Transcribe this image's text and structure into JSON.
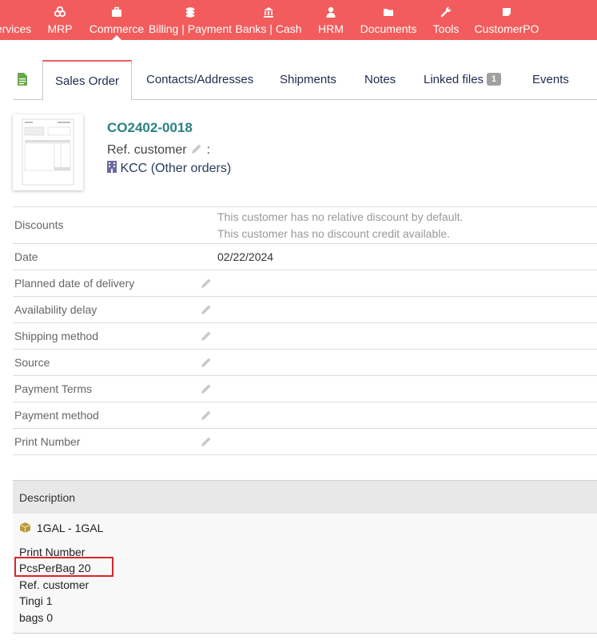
{
  "topnav": {
    "items": [
      {
        "label": "ervices",
        "icon": "services-icon"
      },
      {
        "label": "MRP",
        "icon": "cubes-icon"
      },
      {
        "label": "Commerce",
        "icon": "briefcase-icon",
        "active": true
      },
      {
        "label": "Billing | Payment",
        "icon": "coins-icon"
      },
      {
        "label": "Banks | Cash",
        "icon": "bank-icon"
      },
      {
        "label": "HRM",
        "icon": "user-tie-icon"
      },
      {
        "label": "Documents",
        "icon": "folder-icon"
      },
      {
        "label": "Tools",
        "icon": "wrench-icon"
      },
      {
        "label": "CustomerPO",
        "icon": "sticky-note-icon"
      }
    ],
    "color": "#f25c5c"
  },
  "tabs": {
    "items": [
      {
        "label": "Sales Order",
        "active": true
      },
      {
        "label": "Contacts/Addresses"
      },
      {
        "label": "Shipments"
      },
      {
        "label": "Notes"
      },
      {
        "label": "Linked files",
        "badge": "1"
      },
      {
        "label": "Events"
      }
    ]
  },
  "header": {
    "ref": "CO2402-0018",
    "ref_customer_label": "Ref. customer",
    "ref_customer_sep": ":",
    "thirdparty": "KCC",
    "other_orders": "(Other orders)"
  },
  "fields": {
    "discounts_label": "Discounts",
    "discount_note1": "This customer has no relative discount by default.",
    "discount_note2": "This customer has no discount credit available.",
    "date_label": "Date",
    "date_value": "02/22/2024",
    "planned_delivery_label": "Planned date of delivery",
    "availability_label": "Availability delay",
    "shipping_label": "Shipping method",
    "source_label": "Source",
    "payment_terms_label": "Payment Terms",
    "payment_method_label": "Payment method",
    "print_number_label": "Print Number"
  },
  "lines": {
    "header": "Description",
    "product": "1GAL - 1GAL",
    "extra": [
      "Print Number",
      "PcsPerBag 20",
      "Ref. customer",
      "Tingi 1",
      "bags 0"
    ]
  }
}
